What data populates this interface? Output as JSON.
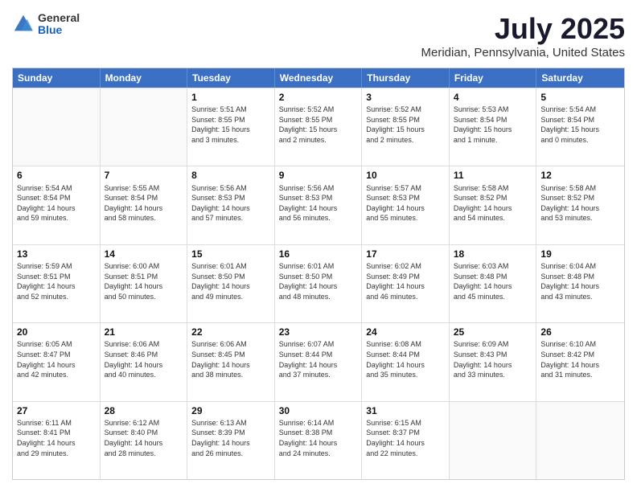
{
  "logo": {
    "general": "General",
    "blue": "Blue"
  },
  "title": "July 2025",
  "subtitle": "Meridian, Pennsylvania, United States",
  "days_of_week": [
    "Sunday",
    "Monday",
    "Tuesday",
    "Wednesday",
    "Thursday",
    "Friday",
    "Saturday"
  ],
  "weeks": [
    [
      {
        "day": "",
        "info": ""
      },
      {
        "day": "",
        "info": ""
      },
      {
        "day": "1",
        "info": "Sunrise: 5:51 AM\nSunset: 8:55 PM\nDaylight: 15 hours\nand 3 minutes."
      },
      {
        "day": "2",
        "info": "Sunrise: 5:52 AM\nSunset: 8:55 PM\nDaylight: 15 hours\nand 2 minutes."
      },
      {
        "day": "3",
        "info": "Sunrise: 5:52 AM\nSunset: 8:55 PM\nDaylight: 15 hours\nand 2 minutes."
      },
      {
        "day": "4",
        "info": "Sunrise: 5:53 AM\nSunset: 8:54 PM\nDaylight: 15 hours\nand 1 minute."
      },
      {
        "day": "5",
        "info": "Sunrise: 5:54 AM\nSunset: 8:54 PM\nDaylight: 15 hours\nand 0 minutes."
      }
    ],
    [
      {
        "day": "6",
        "info": "Sunrise: 5:54 AM\nSunset: 8:54 PM\nDaylight: 14 hours\nand 59 minutes."
      },
      {
        "day": "7",
        "info": "Sunrise: 5:55 AM\nSunset: 8:54 PM\nDaylight: 14 hours\nand 58 minutes."
      },
      {
        "day": "8",
        "info": "Sunrise: 5:56 AM\nSunset: 8:53 PM\nDaylight: 14 hours\nand 57 minutes."
      },
      {
        "day": "9",
        "info": "Sunrise: 5:56 AM\nSunset: 8:53 PM\nDaylight: 14 hours\nand 56 minutes."
      },
      {
        "day": "10",
        "info": "Sunrise: 5:57 AM\nSunset: 8:53 PM\nDaylight: 14 hours\nand 55 minutes."
      },
      {
        "day": "11",
        "info": "Sunrise: 5:58 AM\nSunset: 8:52 PM\nDaylight: 14 hours\nand 54 minutes."
      },
      {
        "day": "12",
        "info": "Sunrise: 5:58 AM\nSunset: 8:52 PM\nDaylight: 14 hours\nand 53 minutes."
      }
    ],
    [
      {
        "day": "13",
        "info": "Sunrise: 5:59 AM\nSunset: 8:51 PM\nDaylight: 14 hours\nand 52 minutes."
      },
      {
        "day": "14",
        "info": "Sunrise: 6:00 AM\nSunset: 8:51 PM\nDaylight: 14 hours\nand 50 minutes."
      },
      {
        "day": "15",
        "info": "Sunrise: 6:01 AM\nSunset: 8:50 PM\nDaylight: 14 hours\nand 49 minutes."
      },
      {
        "day": "16",
        "info": "Sunrise: 6:01 AM\nSunset: 8:50 PM\nDaylight: 14 hours\nand 48 minutes."
      },
      {
        "day": "17",
        "info": "Sunrise: 6:02 AM\nSunset: 8:49 PM\nDaylight: 14 hours\nand 46 minutes."
      },
      {
        "day": "18",
        "info": "Sunrise: 6:03 AM\nSunset: 8:48 PM\nDaylight: 14 hours\nand 45 minutes."
      },
      {
        "day": "19",
        "info": "Sunrise: 6:04 AM\nSunset: 8:48 PM\nDaylight: 14 hours\nand 43 minutes."
      }
    ],
    [
      {
        "day": "20",
        "info": "Sunrise: 6:05 AM\nSunset: 8:47 PM\nDaylight: 14 hours\nand 42 minutes."
      },
      {
        "day": "21",
        "info": "Sunrise: 6:06 AM\nSunset: 8:46 PM\nDaylight: 14 hours\nand 40 minutes."
      },
      {
        "day": "22",
        "info": "Sunrise: 6:06 AM\nSunset: 8:45 PM\nDaylight: 14 hours\nand 38 minutes."
      },
      {
        "day": "23",
        "info": "Sunrise: 6:07 AM\nSunset: 8:44 PM\nDaylight: 14 hours\nand 37 minutes."
      },
      {
        "day": "24",
        "info": "Sunrise: 6:08 AM\nSunset: 8:44 PM\nDaylight: 14 hours\nand 35 minutes."
      },
      {
        "day": "25",
        "info": "Sunrise: 6:09 AM\nSunset: 8:43 PM\nDaylight: 14 hours\nand 33 minutes."
      },
      {
        "day": "26",
        "info": "Sunrise: 6:10 AM\nSunset: 8:42 PM\nDaylight: 14 hours\nand 31 minutes."
      }
    ],
    [
      {
        "day": "27",
        "info": "Sunrise: 6:11 AM\nSunset: 8:41 PM\nDaylight: 14 hours\nand 29 minutes."
      },
      {
        "day": "28",
        "info": "Sunrise: 6:12 AM\nSunset: 8:40 PM\nDaylight: 14 hours\nand 28 minutes."
      },
      {
        "day": "29",
        "info": "Sunrise: 6:13 AM\nSunset: 8:39 PM\nDaylight: 14 hours\nand 26 minutes."
      },
      {
        "day": "30",
        "info": "Sunrise: 6:14 AM\nSunset: 8:38 PM\nDaylight: 14 hours\nand 24 minutes."
      },
      {
        "day": "31",
        "info": "Sunrise: 6:15 AM\nSunset: 8:37 PM\nDaylight: 14 hours\nand 22 minutes."
      },
      {
        "day": "",
        "info": ""
      },
      {
        "day": "",
        "info": ""
      }
    ]
  ]
}
